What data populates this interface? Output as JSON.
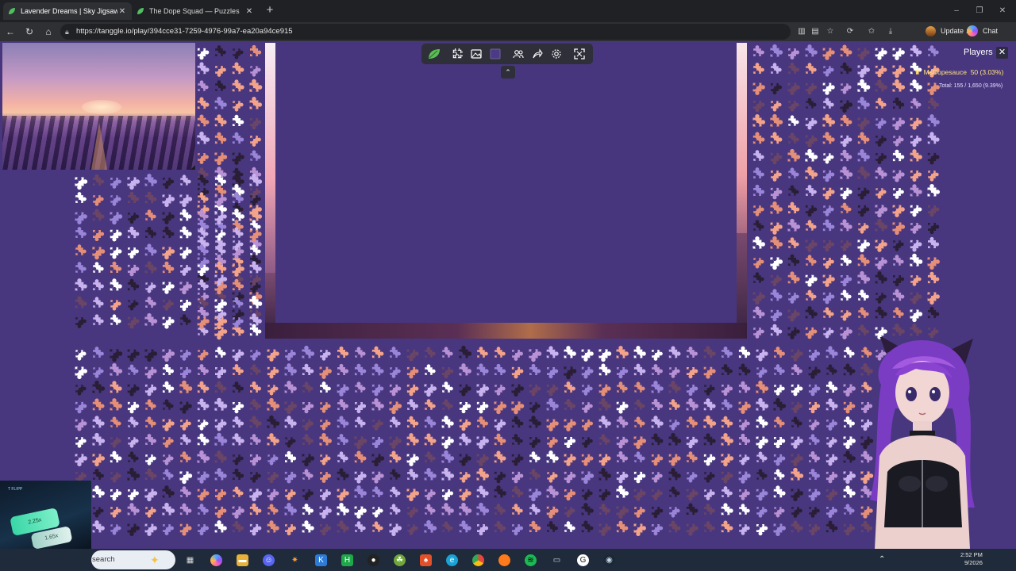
{
  "browser": {
    "tabs": [
      {
        "title": "Lavender Dreams | Sky Jigsaw",
        "active": true
      },
      {
        "title": "The Dope Squad — Puzzles",
        "active": false
      }
    ],
    "new_tab": "+",
    "url": "https://tanggle.io/play/394cce31-7259-4976-99a7-ea20a94ce915",
    "update_label": "Update",
    "update_more": "…",
    "chat_label": "Chat"
  },
  "game": {
    "players_title": "Players",
    "players": [
      {
        "name": "MsDopesauce",
        "score": "50 (3.03%)"
      }
    ],
    "total": "Total: 155 / 1,650 (9.39%)",
    "colors": {
      "background": "#48377f",
      "piece_palette": [
        "#ffffff",
        "#f3a38a",
        "#9a85d8",
        "#c9b3ef",
        "#2a1e36",
        "#6a4566",
        "#e58f78",
        "#b892d4"
      ]
    }
  },
  "pip": {
    "tag": "T FLIPP",
    "chip1": "2.25x",
    "chip2": "1.65x"
  },
  "taskbar": {
    "search_placeholder": "search",
    "time": "2:52 PM",
    "date": "9/2026"
  }
}
